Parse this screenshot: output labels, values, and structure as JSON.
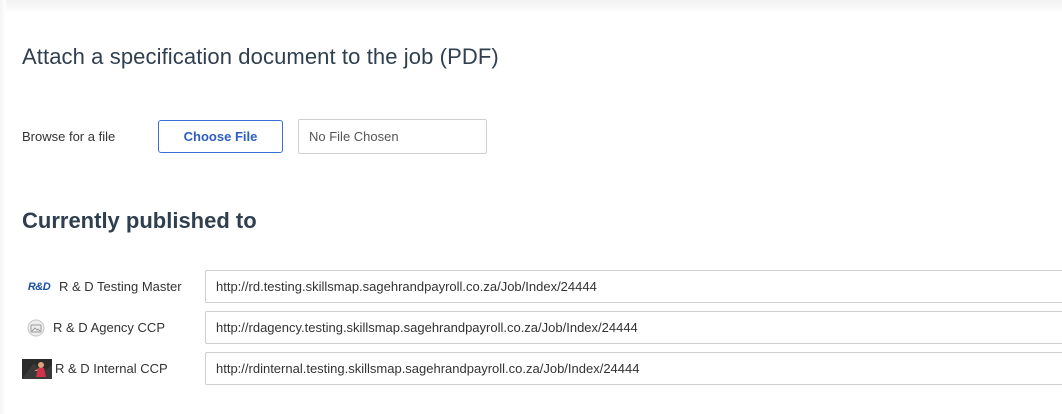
{
  "attach": {
    "title": "Attach a specification document to the job (PDF)",
    "browse_label": "Browse for a file",
    "choose_button": "Choose File",
    "file_status": "No File Chosen"
  },
  "published": {
    "title": "Currently published to",
    "items": [
      {
        "logo_text": "R&D",
        "name": "R & D Testing Master",
        "url": "http://rd.testing.skillsmap.sagehrandpayroll.co.za/Job/Index/24444",
        "icon": "rd-logo-icon"
      },
      {
        "name": "R & D Agency CCP",
        "url": "http://rdagency.testing.skillsmap.sagehrandpayroll.co.za/Job/Index/24444",
        "icon": "image-placeholder-icon"
      },
      {
        "name": "R & D Internal CCP",
        "url": "http://rdinternal.testing.skillsmap.sagehrandpayroll.co.za/Job/Index/24444",
        "icon": "person-photo-icon"
      }
    ]
  },
  "colors": {
    "accent": "#3b6fd4",
    "heading": "#2f3f4f",
    "border": "#cfcfcf"
  }
}
